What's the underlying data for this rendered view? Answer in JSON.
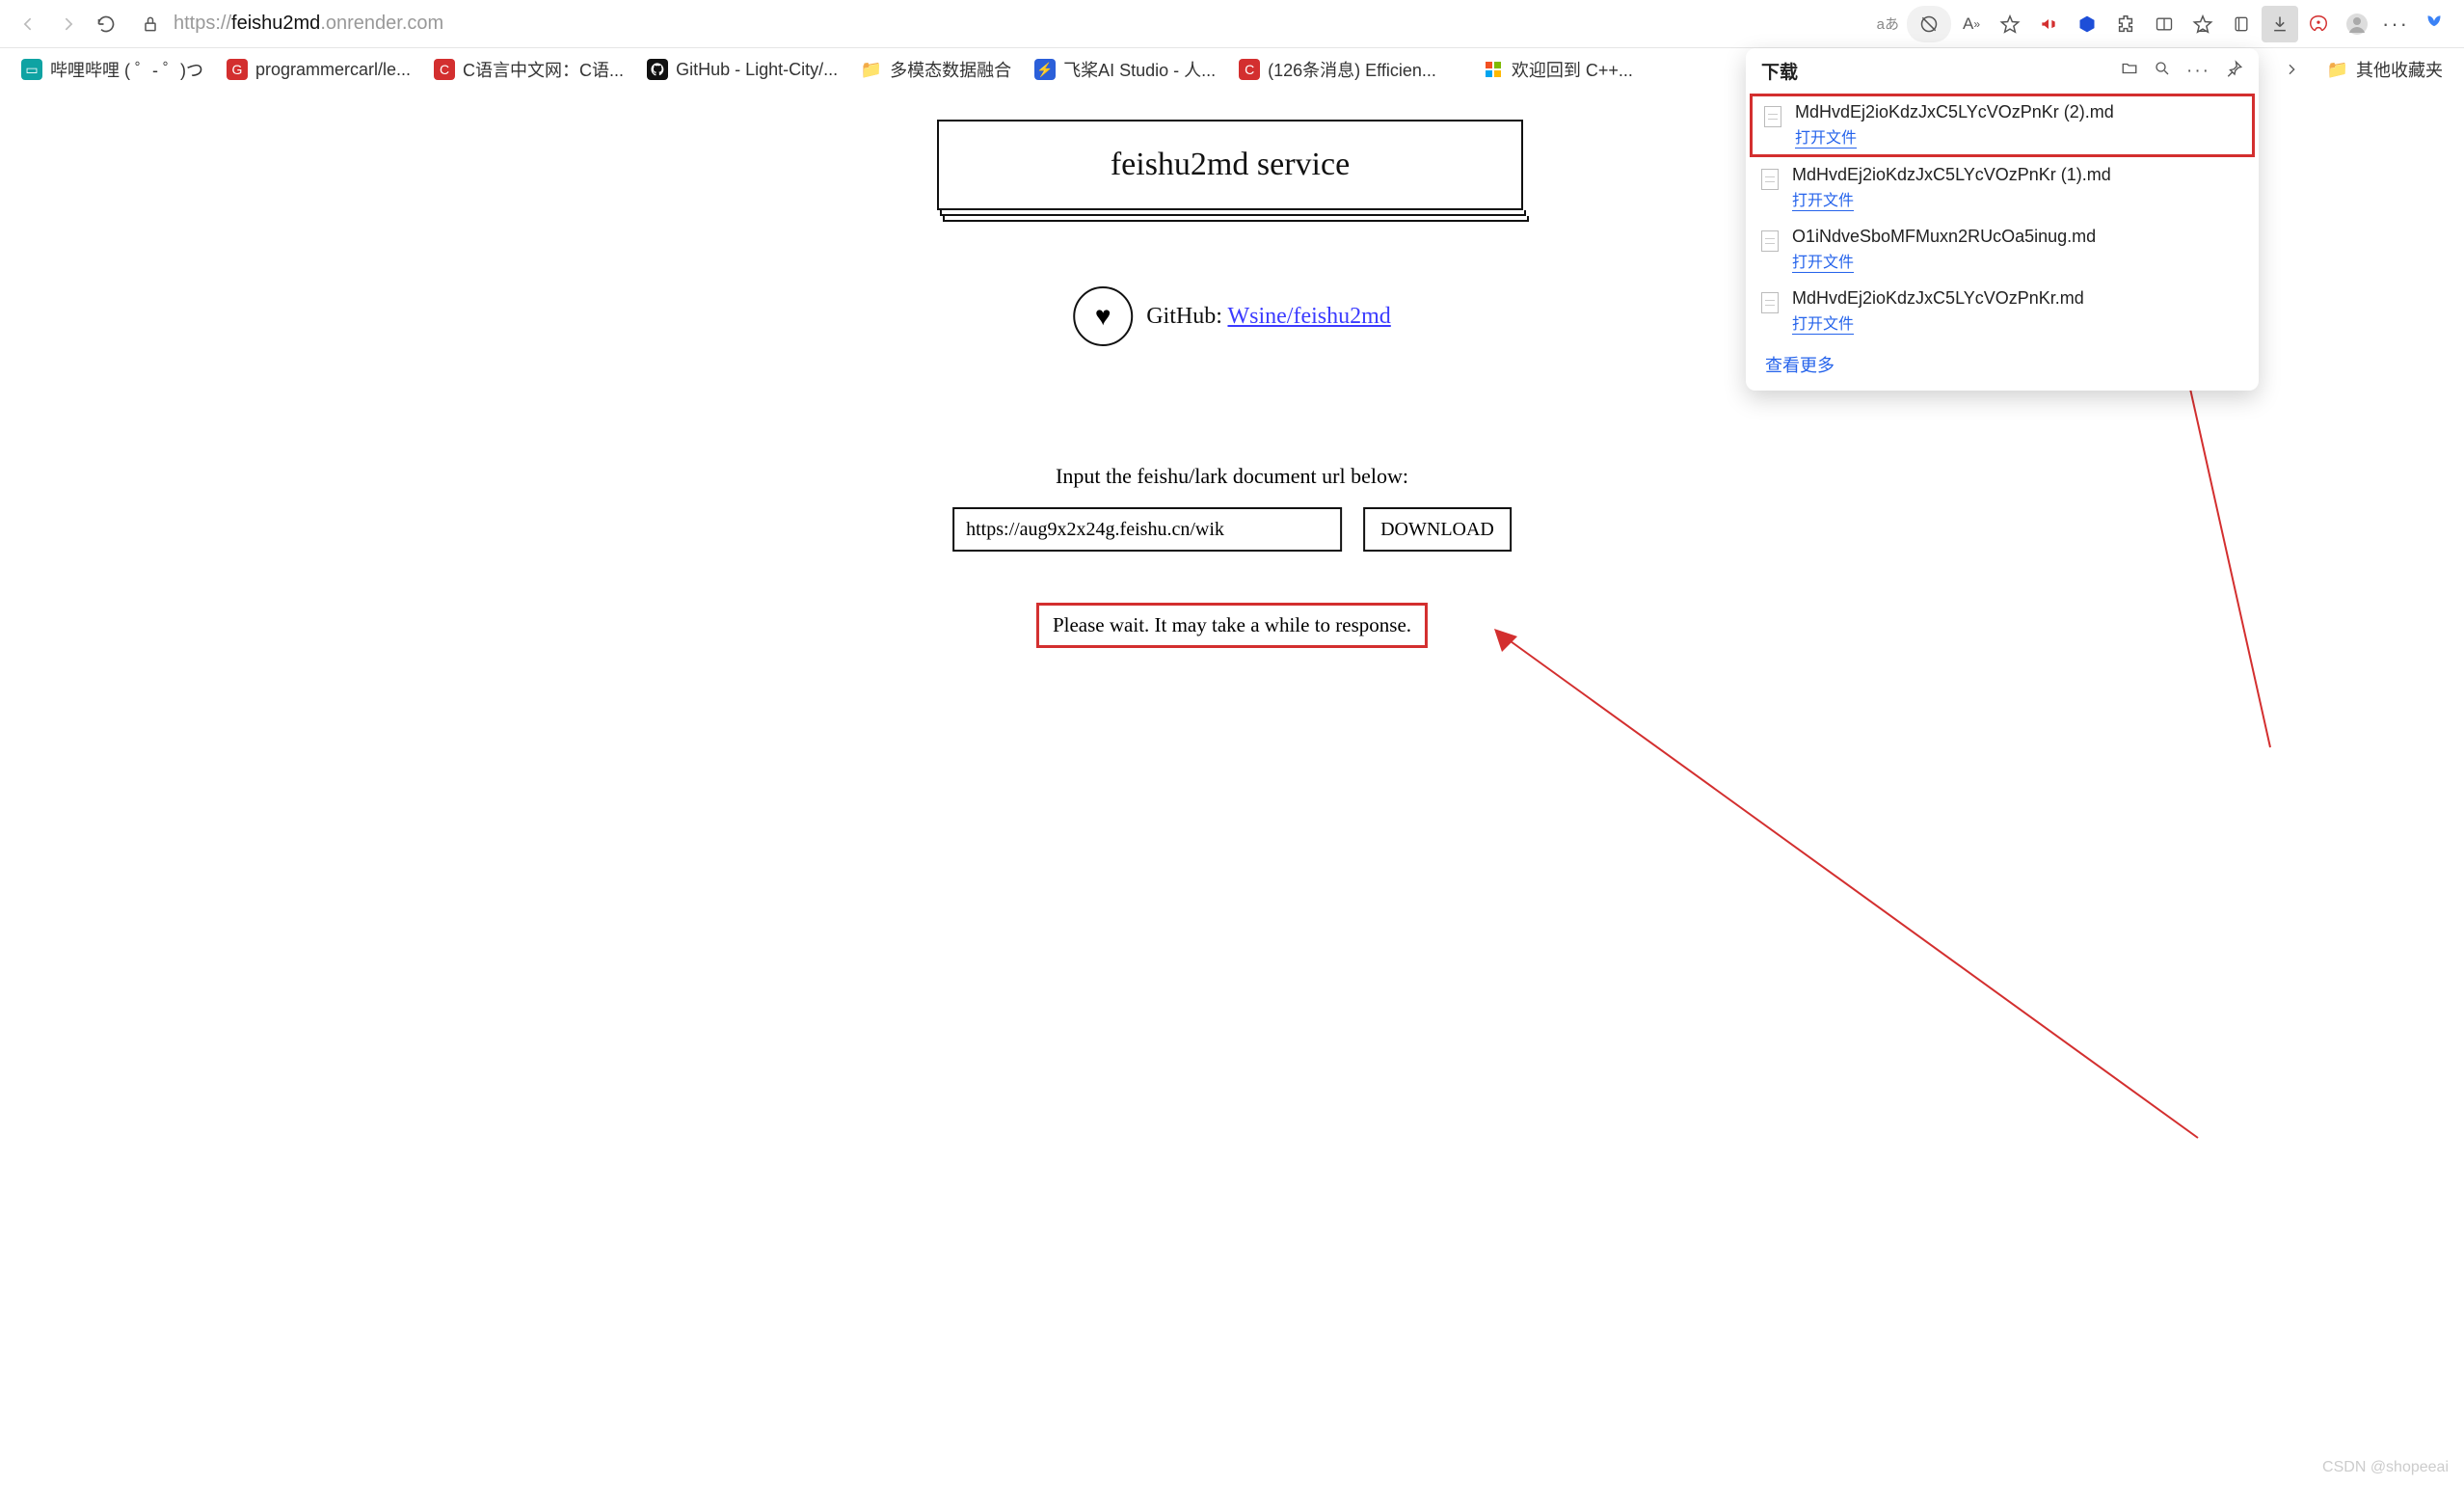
{
  "url": {
    "prefix": "https://",
    "host": "feishu2md",
    "suffix": ".onrender.com"
  },
  "addr_btns": {
    "lang": "aあ"
  },
  "bookmarks": [
    {
      "label": "哔哩哔哩 ( ゜- ゜)つ",
      "iconClass": "teal",
      "glyph": "▭"
    },
    {
      "label": "programmercarl/le...",
      "iconClass": "red",
      "glyph": "G"
    },
    {
      "label": "C语言中文网：C语...",
      "iconClass": "red",
      "glyph": "C"
    },
    {
      "label": "GitHub - Light-City/...",
      "iconClass": "blk",
      "glyph": ""
    },
    {
      "label": "多模态数据融合",
      "iconClass": "fld",
      "glyph": "📁"
    },
    {
      "label": "飞桨AI Studio - 人...",
      "iconClass": "blue",
      "glyph": "⚡"
    },
    {
      "label": "(126条消息) Efficien...",
      "iconClass": "red",
      "glyph": "C"
    },
    {
      "label": "",
      "iconClass": "page",
      "glyph": "🗎"
    },
    {
      "label": "欢迎回到 C++...",
      "iconClass": "grid",
      "glyph": "⊞"
    }
  ],
  "other_favorites": "其他收藏夹",
  "page_content": {
    "title": "feishu2md service",
    "github_prefix": "GitHub:",
    "github_link": "Wsine/feishu2md",
    "prompt": "Input the feishu/lark document url below:",
    "input_value": "https://aug9x2x24g.feishu.cn/wik",
    "download_btn": "DOWNLOAD",
    "wait_msg": "Please wait. It may take a while to response."
  },
  "downloads": {
    "title": "下载",
    "open_file": "打开文件",
    "see_more": "查看更多",
    "items": [
      "MdHvdEj2ioKdzJxC5LYcVOzPnKr (2).md",
      "MdHvdEj2ioKdzJxC5LYcVOzPnKr (1).md",
      "O1iNdveSboMFMuxn2RUcOa5inug.md",
      "MdHvdEj2ioKdzJxC5LYcVOzPnKr.md"
    ]
  },
  "watermark": "CSDN @shopeeai"
}
